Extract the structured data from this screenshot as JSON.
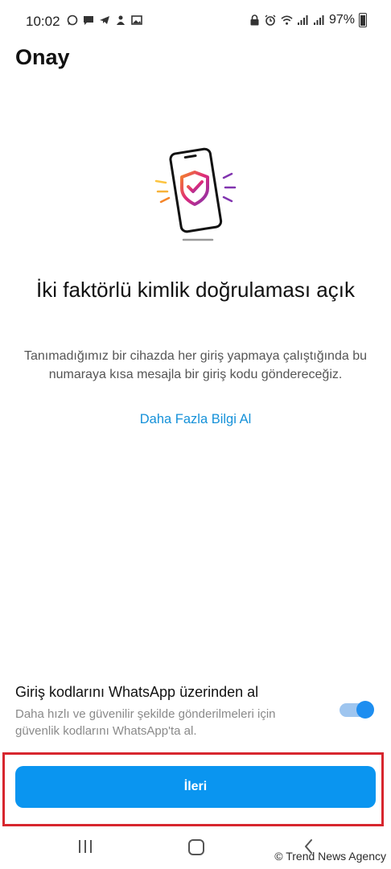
{
  "status_bar": {
    "time": "10:02",
    "battery": "97%",
    "left_icons": [
      "whatsapp-icon",
      "message-icon",
      "telegram-icon",
      "notification-icon",
      "gallery-icon"
    ],
    "right_icons": [
      "lock-icon",
      "alarm-icon",
      "wifi-icon",
      "signal-icon",
      "signal-icon",
      "battery-icon"
    ]
  },
  "header": {
    "title": "Onay"
  },
  "main": {
    "headline": "İki faktörlü kimlik doğrulaması açık",
    "description": "Tanımadığımız bir cihazda her giriş yapmaya çalıştığında bu numaraya kısa mesajla bir giriş kodu göndereceğiz.",
    "learn_more": "Daha Fazla Bilgi Al"
  },
  "whatsapp_option": {
    "title": "Giriş kodlarını WhatsApp üzerinden al",
    "description": "Daha hızlı ve güvenilir şekilde gönderilmeleri için güvenlik kodlarını WhatsApp'ta al.",
    "enabled": true
  },
  "footer": {
    "next_label": "İleri"
  },
  "watermark": "© Trend News Agency",
  "colors": {
    "accent": "#0a95f0",
    "link": "#1591d9",
    "toggle_thumb": "#1e8ef0",
    "highlight": "#d7262e"
  }
}
